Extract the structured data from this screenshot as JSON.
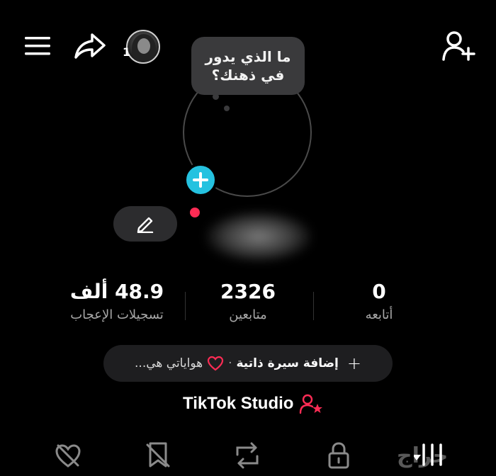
{
  "header": {
    "story_count": "1"
  },
  "bubble": {
    "line1": "ما الذي يدور",
    "line2": "في ذهنك؟"
  },
  "stats": {
    "likes": {
      "value": "48.9 ألف",
      "label": "تسجيلات الإعجاب"
    },
    "followers": {
      "value": "2326",
      "label": "متابعين"
    },
    "following": {
      "value": "0",
      "label": "أتابعه"
    }
  },
  "bio": {
    "plus": "+",
    "add_label": "إضافة سيرة ذاتية",
    "separator": "·",
    "hobbies": "هواياتي هي..."
  },
  "studio": {
    "label": "TikTok Studio"
  },
  "watermark": {
    "text": "حراج"
  },
  "colors": {
    "accent_cyan": "#25c2e0",
    "accent_red": "#fe2c55",
    "pill_bg": "#2c2c2e"
  },
  "icons": [
    "menu-icon",
    "share-icon",
    "add-friend-icon",
    "edit-icon",
    "plus-icon",
    "heart-icon",
    "studio-icon",
    "liked-icon",
    "favorites-icon",
    "reposts-icon",
    "private-icon",
    "videos-icon"
  ]
}
